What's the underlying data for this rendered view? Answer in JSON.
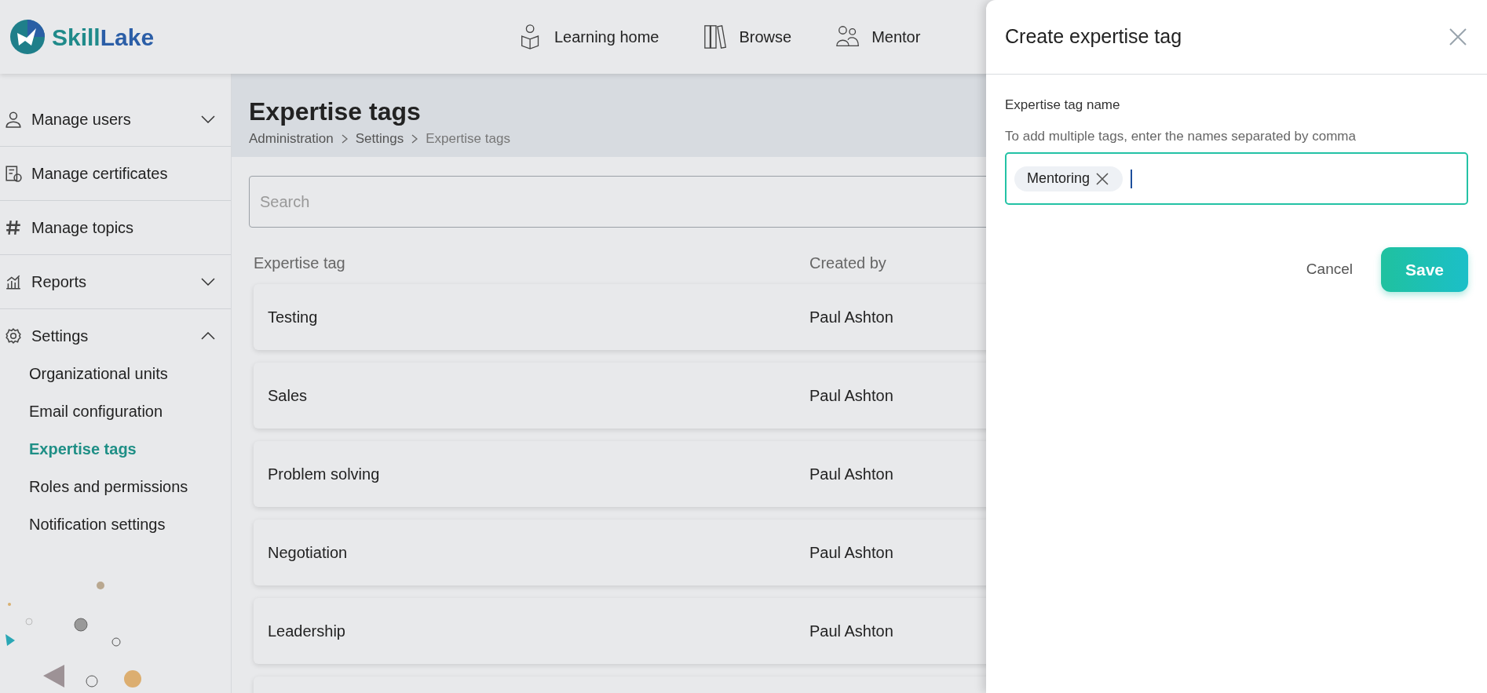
{
  "header": {
    "logo": {
      "first": "Skill",
      "second": "Lake"
    },
    "nav": [
      {
        "label": "Learning home"
      },
      {
        "label": "Browse"
      },
      {
        "label": "Mentor"
      }
    ]
  },
  "sidebar": {
    "items": [
      {
        "label": "Manage users",
        "expanded": false
      },
      {
        "label": "Manage certificates"
      },
      {
        "label": "Manage topics"
      },
      {
        "label": "Reports",
        "expanded": false
      },
      {
        "label": "Settings",
        "expanded": true,
        "children": [
          {
            "label": "Organizational units",
            "selected": false
          },
          {
            "label": "Email configuration",
            "selected": false
          },
          {
            "label": "Expertise tags",
            "selected": true
          },
          {
            "label": "Roles and permissions",
            "selected": false
          },
          {
            "label": "Notification settings",
            "selected": false
          }
        ]
      }
    ]
  },
  "page": {
    "title": "Expertise tags",
    "breadcrumb": [
      "Administration",
      "Settings",
      "Expertise tags"
    ],
    "search": {
      "placeholder": "Search"
    },
    "table": {
      "columns": [
        "Expertise tag",
        "Created by"
      ],
      "rows": [
        [
          "Testing",
          "Paul Ashton"
        ],
        [
          "Sales",
          "Paul Ashton"
        ],
        [
          "Problem solving",
          "Paul Ashton"
        ],
        [
          "Negotiation",
          "Paul Ashton"
        ],
        [
          "Leadership",
          "Paul Ashton"
        ]
      ]
    }
  },
  "panel": {
    "title": "Create expertise tag",
    "field": {
      "label": "Expertise tag name",
      "hint": "To add multiple tags, enter the names separated by comma",
      "tags": [
        "Mentoring"
      ]
    },
    "buttons": [
      {
        "label": "Cancel",
        "kind": "text"
      },
      {
        "label": "Save",
        "kind": "primary"
      }
    ]
  }
}
